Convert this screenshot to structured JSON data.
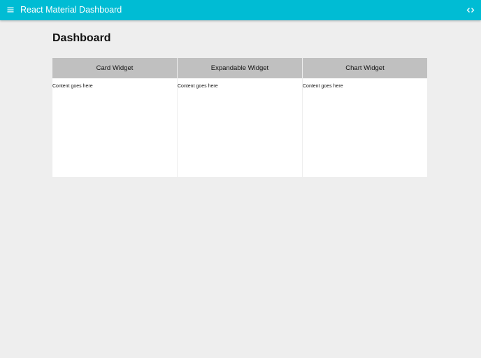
{
  "app_bar": {
    "title": "React Material Dashboard",
    "menu_icon": "menu-icon",
    "code_icon": "code-icon",
    "color": "#00bcd4"
  },
  "page": {
    "title": "Dashboard",
    "background": "#eeeeee"
  },
  "widgets": [
    {
      "title": "Card Widget",
      "content": "Content goes here"
    },
    {
      "title": "Expandable Widget",
      "content": "Content goes here"
    },
    {
      "title": "Chart Widget",
      "content": "Content goes here"
    }
  ]
}
